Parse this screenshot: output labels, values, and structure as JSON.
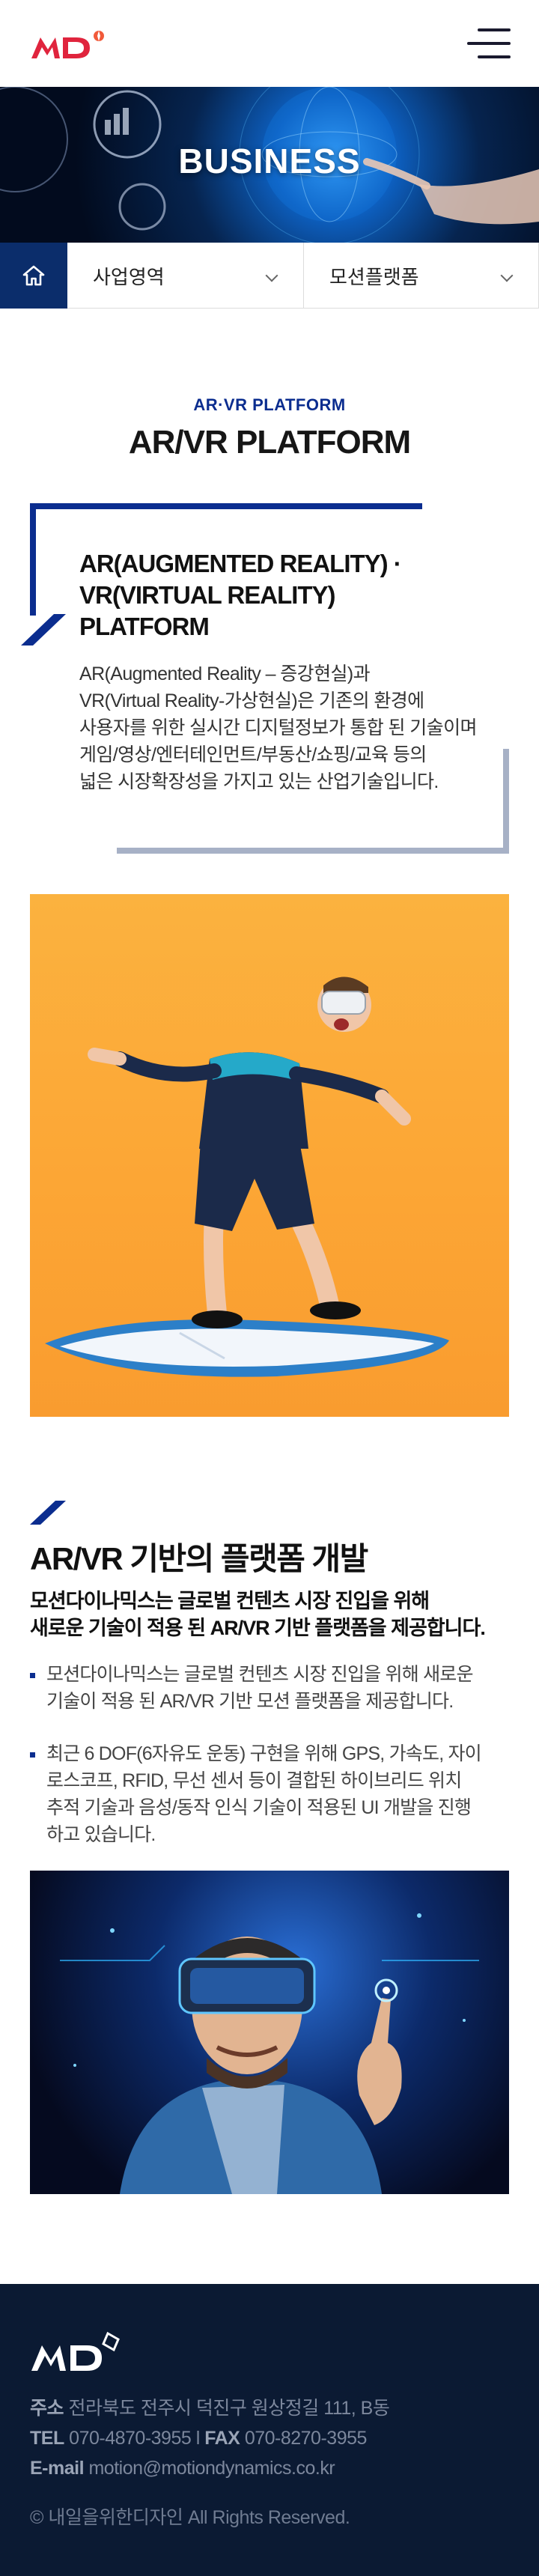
{
  "header": {
    "logo_text": "MD",
    "menu_icon": "hamburger-menu-icon"
  },
  "hero": {
    "title": "BUSINESS"
  },
  "subnav": {
    "home_icon": "home-icon",
    "primary_select": "사업영역",
    "secondary_select": "모션플랫폼"
  },
  "section": {
    "eyebrow": "AR·VR PLATFORM",
    "title": "AR/VR PLATFORM"
  },
  "intro": {
    "heading_lines": [
      "AR(AUGMENTED REALITY) ·",
      "VR(VIRTUAL REALITY)",
      "PLATFORM"
    ],
    "body_lines": [
      "AR(Augmented Reality – 증강현실)과",
      "VR(Virtual Reality-가상현실)은 기존의 환경에",
      "사용자를 위한 실시간 디지털정보가 통합 된 기술이며",
      "게임/영상/엔터테인먼트/부동산/쇼핑/교육 등의",
      "넓은 시장확장성을 가지고 있는 산업기술입니다."
    ]
  },
  "platform": {
    "title": "AR/VR 기반의 플랫폼 개발",
    "lead_lines": [
      "모션다이나믹스는 글로벌 컨텐츠 시장 진입을 위해",
      "새로운 기술이 적용 된 AR/VR 기반 플랫폼을 제공합니다."
    ],
    "bullets": [
      {
        "lines": [
          "모션다이나믹스는 글로벌 컨텐츠 시장 진입을 위해 새로운",
          "기술이 적용 된 AR/VR 기반 모션 플랫폼을 제공합니다."
        ]
      },
      {
        "lines": [
          "최근 6 DOF(6자유도 운동) 구현을 위해 GPS, 가속도, 자이",
          "로스코프, RFID, 무선 센서 등이 결합된 하이브리드 위치",
          "추적 기술과 음성/동작 인식 기술이 적용된 UI 개발을 진행",
          "하고 있습니다."
        ]
      }
    ]
  },
  "footer": {
    "address_label": "주소",
    "address": "전라북도 전주시 덕진구 원상정길 111, B동",
    "tel_label": "TEL",
    "tel": "070-4870-3955",
    "separator": "l",
    "fax_label": "FAX",
    "fax": "070-8270-3955",
    "email_label": "E-mail",
    "email": "motion@motiondynamics.co.kr",
    "copyright": "© 내일을위한디자인  All Rights Reserved."
  },
  "colors": {
    "brand_red": "#e0243d",
    "navy": "#0b2d8f",
    "dark_navy": "#0b2d6b",
    "footer_bg": "#0b1a33",
    "gray_frame": "#a7b1c6",
    "orange_bg": "#fca635"
  }
}
